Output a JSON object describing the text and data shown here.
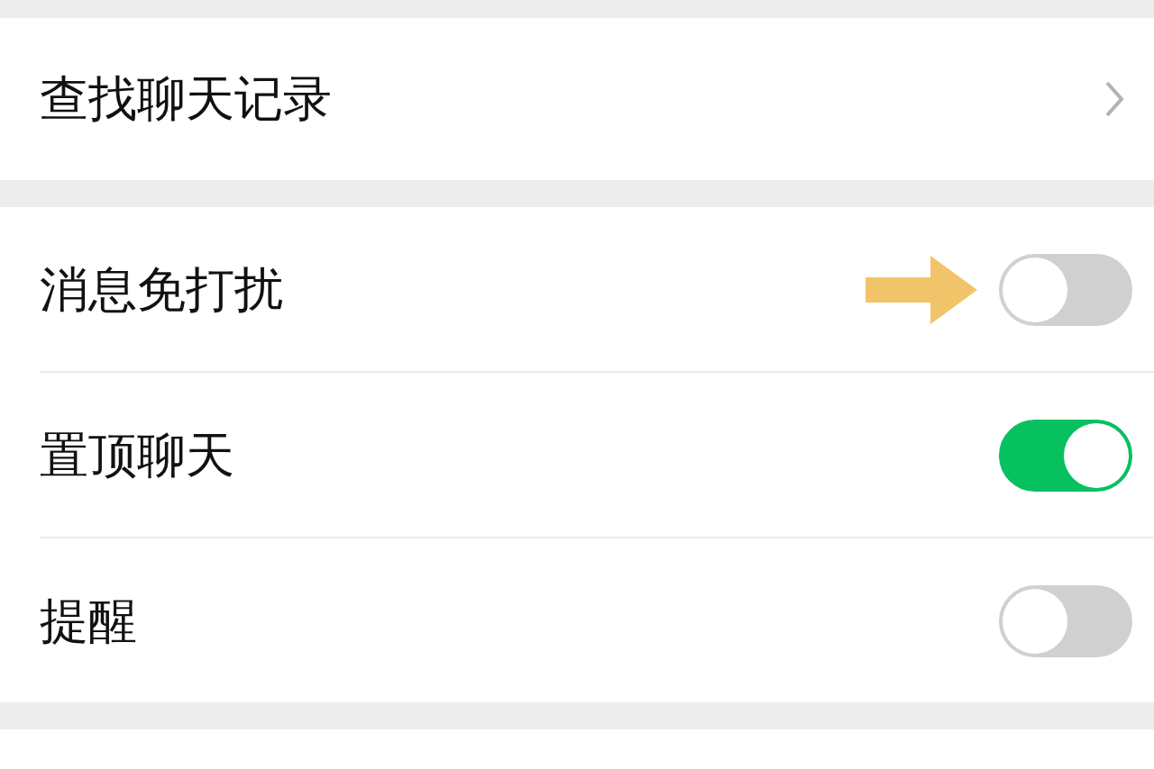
{
  "search_row": {
    "label": "查找聊天记录"
  },
  "toggles": [
    {
      "label": "消息免打扰",
      "on": false,
      "pointed": true
    },
    {
      "label": "置顶聊天",
      "on": true,
      "pointed": false
    },
    {
      "label": "提醒",
      "on": false,
      "pointed": false
    }
  ]
}
